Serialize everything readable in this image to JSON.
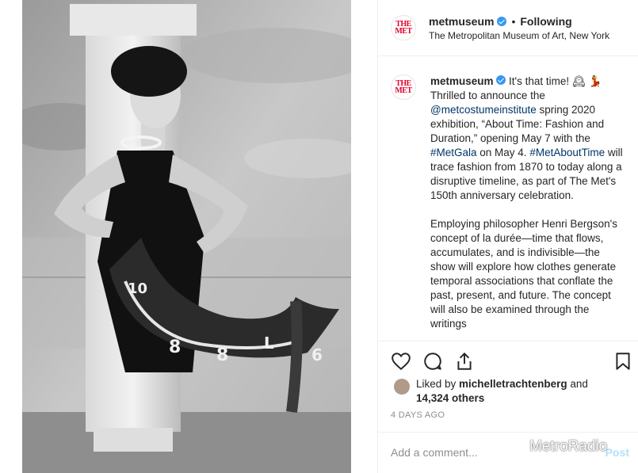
{
  "header": {
    "avatar_line1": "THE",
    "avatar_line2": "MET",
    "username": "metmuseum",
    "separator": "•",
    "follow_status": "Following",
    "location": "The Metropolitan Museum of Art, New York"
  },
  "caption": {
    "username": "metmuseum",
    "line1_text": " It's that time! ",
    "emoji": "🕰 💃",
    "para1_a": "Thrilled to announce the ",
    "mention": "@metcostumeinstitute",
    "para1_b": " spring 2020 exhibition, “About Time: Fashion and Duration,” opening May 7 with the ",
    "hashtag1": "#MetGala",
    "para1_c": " on May 4. ",
    "hashtag2": "#MetAboutTime",
    "para1_d": " will trace fashion from 1870 to today along a disruptive timeline, as part of The Met's 150th anniversary celebration.",
    "para2": "Employing philosopher Henri Bergson's concept of la durée—time that flows, accumulates, and is indivisible—the show will explore how clothes generate temporal associations that conflate the past, present, and future. The concept will also be examined through the writings"
  },
  "actions": {
    "like_icon": "heart-icon",
    "comment_icon": "comment-icon",
    "share_icon": "share-icon",
    "save_icon": "bookmark-icon"
  },
  "likes": {
    "prefix": "Liked by ",
    "user": "michelletrachtenberg",
    "mid": " and",
    "count": "14,324 others"
  },
  "timestamp": "4 DAYS AGO",
  "comment_box": {
    "placeholder": "Add a comment...",
    "post_label": "Post"
  },
  "watermark": "MetroRadio"
}
